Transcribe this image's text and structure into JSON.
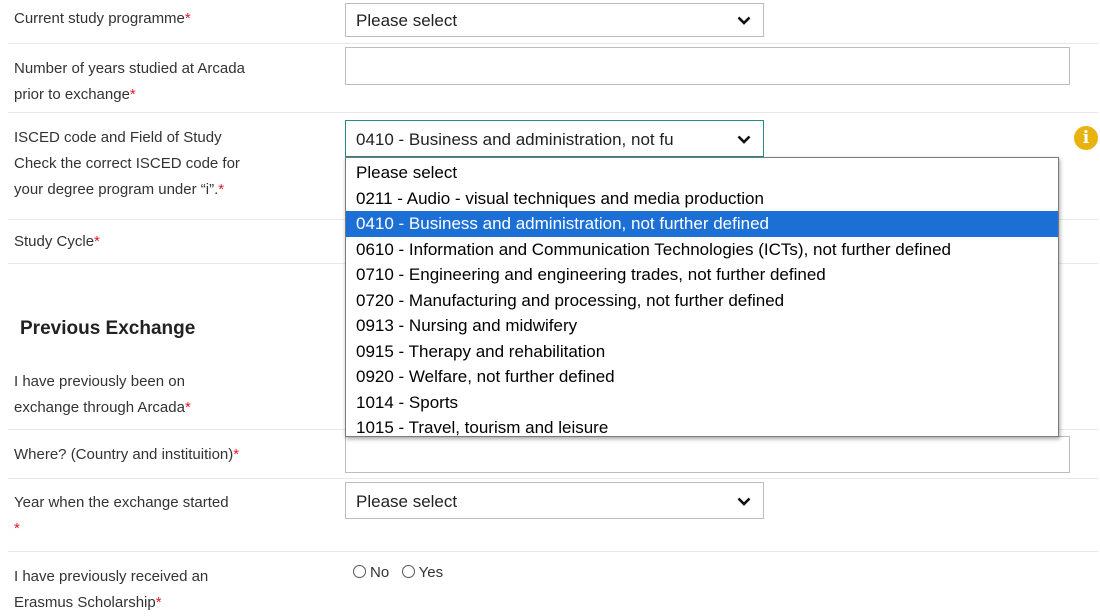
{
  "fields": {
    "study_programme": {
      "label": "Current study programme",
      "value": "Please select"
    },
    "years_studied": {
      "label_line1": "Number of years studied at Arcada",
      "label_line2": "prior to exchange",
      "value": ""
    },
    "isced": {
      "label_line1": "ISCED code and Field of Study",
      "label_line2": "Check the correct ISCED code for",
      "label_line3": "your degree program under “i”.",
      "value": "0410 - Business and administration, not fu",
      "info_icon": "i"
    },
    "study_cycle": {
      "label": "Study Cycle"
    },
    "where": {
      "label": "Where? (Country and instituition)",
      "value": ""
    },
    "year_started": {
      "label": "Year when the exchange started",
      "value": "Please select"
    },
    "erasmus": {
      "label_line1": "I have previously received an",
      "label_line2": "Erasmus Scholarship",
      "options": [
        "No",
        "Yes"
      ]
    },
    "previous_exchange": {
      "label_line1": "I have previously been on",
      "label_line2": "exchange through Arcada"
    }
  },
  "sections": {
    "previous_exchange_heading": "Previous Exchange"
  },
  "required_marker": "*",
  "dropdown": {
    "selected_index": 2,
    "options": [
      "Please select",
      "0211 - Audio - visual techniques and media production",
      "0410 - Business and administration, not further defined",
      "0610 - Information and Communication Technologies (ICTs), not further defined",
      "0710 - Engineering and engineering trades, not further defined",
      "0720 - Manufacturing and processing, not further defined",
      "0913 - Nursing and midwifery",
      "0915 - Therapy and rehabilitation",
      "0920 - Welfare, not further defined",
      "1014 - Sports",
      "1015 - Travel, tourism and leisure"
    ]
  },
  "colors": {
    "required": "#e0182f",
    "highlight": "#1c6fd4",
    "info": "#e8b20f"
  }
}
